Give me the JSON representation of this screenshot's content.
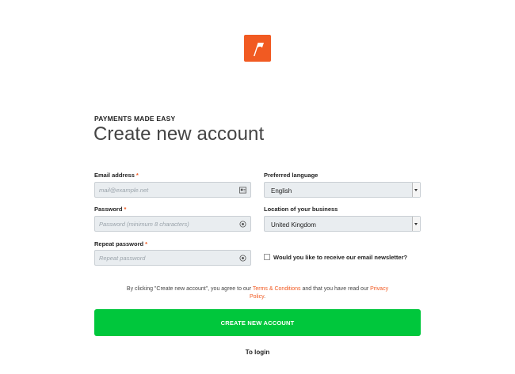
{
  "brand": {
    "accent_color": "#f15a22",
    "button_color": "#00c73c",
    "logo_icon": "paymill-logo"
  },
  "header": {
    "tagline": "PAYMENTS MADE EASY",
    "title": "Create new account"
  },
  "form": {
    "email": {
      "label": "Email address",
      "required": "*",
      "placeholder": "mail@example.net",
      "value": "",
      "icon": "id-card-icon"
    },
    "password": {
      "label": "Password",
      "required": "*",
      "placeholder": "Password (minimum 8 characters)",
      "value": "",
      "icon": "eye-icon"
    },
    "repeat_password": {
      "label": "Repeat password",
      "required": "*",
      "placeholder": "Repeat password",
      "value": "",
      "icon": "eye-icon"
    },
    "language": {
      "label": "Preferred language",
      "value": "English"
    },
    "location": {
      "label": "Location of your business",
      "value": "United Kingdom"
    },
    "newsletter": {
      "label": "Would you like to receive our email newsletter?",
      "checked": false
    }
  },
  "terms": {
    "text_before": "By clicking \"Create new account\", you agree to our ",
    "terms_link": "Terms & Conditions",
    "text_middle": " and that you have read our ",
    "privacy_link": "Privacy Policy",
    "text_after": "."
  },
  "actions": {
    "submit_label": "CREATE NEW ACCOUNT",
    "login_label": "To login"
  }
}
